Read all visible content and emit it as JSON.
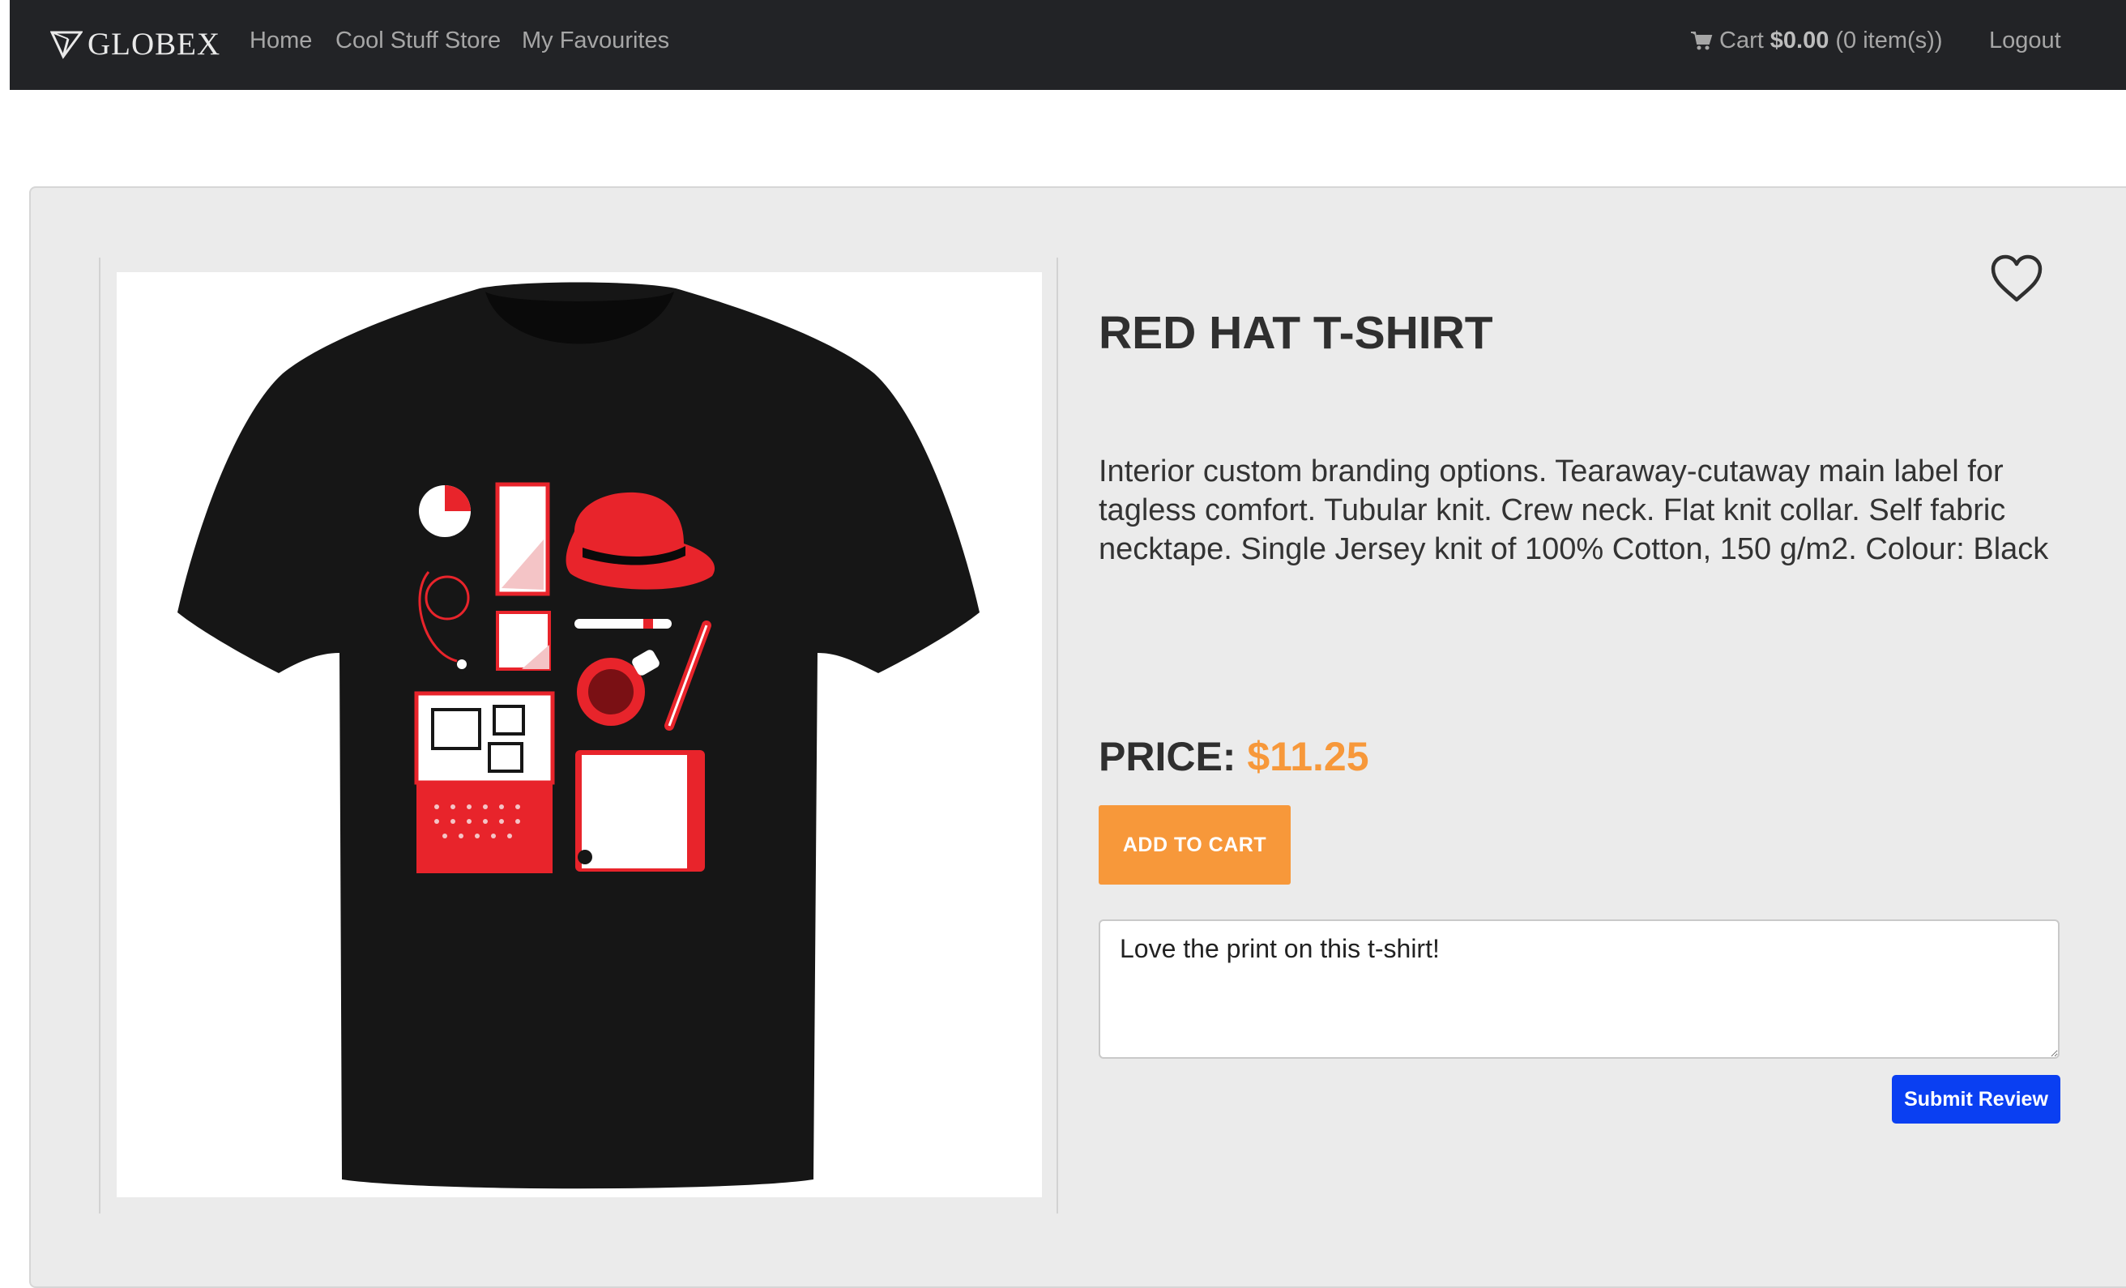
{
  "nav": {
    "brand": "GLOBEX",
    "links": [
      "Home",
      "Cool Stuff Store",
      "My Favourites"
    ],
    "cart": {
      "prefix": "Cart",
      "amount": "$0.00",
      "items": "(0 item(s))"
    },
    "logout": "Logout"
  },
  "product": {
    "title": "RED HAT T-SHIRT",
    "description": "Interior custom branding options. Tearaway-cutaway main label for tagless comfort. Tubular knit. Crew neck. Flat knit collar. Self fabric necktape. Single Jersey knit of 100% Cotton, 150 g/m2. Colour: Black",
    "price_label": "PRICE:",
    "price": "$11.25",
    "add_to_cart": "Add to Cart",
    "favourite_icon": "heart-outline-icon"
  },
  "review": {
    "value": "Love the print on this t-shirt!",
    "submit": "Submit Review"
  },
  "colors": {
    "navbar": "#222326",
    "accent": "#f7983a",
    "submit": "#0a3ff2",
    "panel": "#ebebeb",
    "shirt_print": "#e8242b"
  }
}
